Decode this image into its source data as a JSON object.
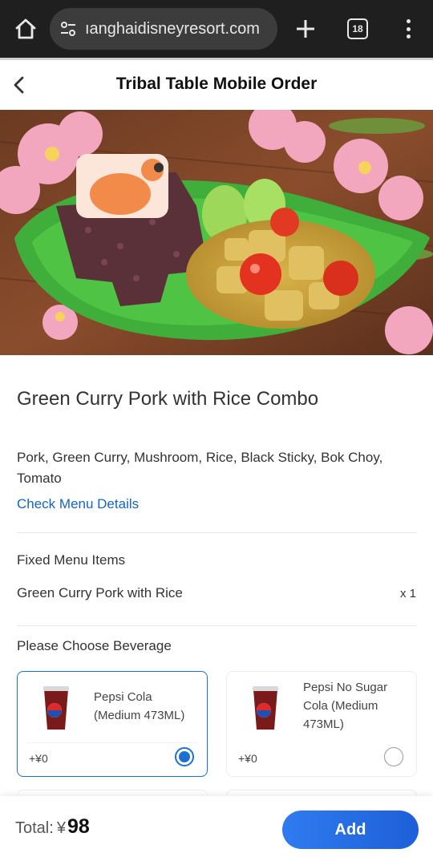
{
  "browser": {
    "url": "ıanghaidisneyresort.com",
    "tab_count": "18"
  },
  "header": {
    "title": "Tribal Table Mobile Order"
  },
  "product": {
    "name": "Green Curry Pork with Rice Combo",
    "description": "Pork, Green Curry, Mushroom, Rice, Black Sticky, Bok Choy, Tomato",
    "menu_link": "Check Menu Details"
  },
  "fixed_menu": {
    "label": "Fixed Menu Items",
    "item_name": "Green Curry Pork with Rice",
    "item_qty": "x 1"
  },
  "beverage": {
    "label": "Please Choose Beverage",
    "options": [
      {
        "name": "Pepsi Cola (Medium 473ML)",
        "price": "+¥0",
        "selected": true
      },
      {
        "name": "Pepsi No Sugar Cola (Medium 473ML)",
        "price": "+¥0",
        "selected": false
      }
    ]
  },
  "footer": {
    "total_label": "Total:",
    "currency": "¥",
    "total_amount": "98",
    "add_label": "Add"
  },
  "colors": {
    "accent": "#1f6fd1",
    "link": "#1565c0",
    "browser_bar": "#1f1f1f"
  },
  "icons": [
    "home-icon",
    "site-settings-icon",
    "plus-icon",
    "tab-switcher-icon",
    "more-vert-icon",
    "back-chevron-icon",
    "radio-selected-icon",
    "radio-unselected-icon"
  ]
}
